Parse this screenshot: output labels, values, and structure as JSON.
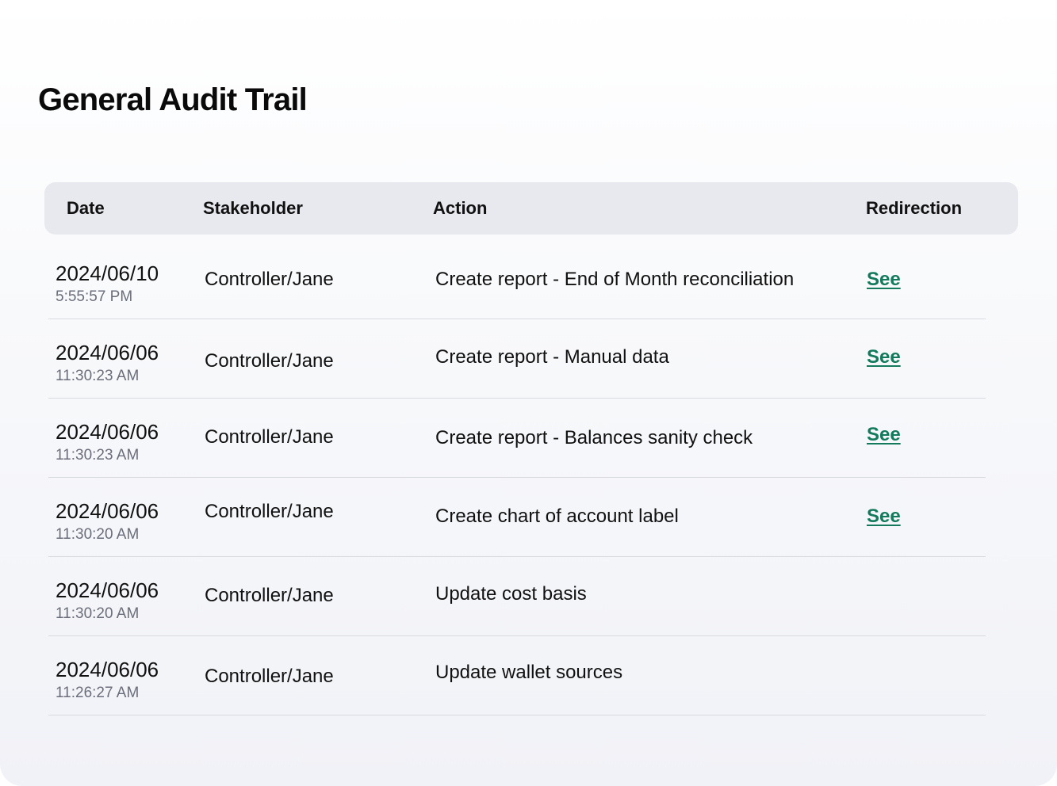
{
  "page": {
    "title": "General Audit Trail"
  },
  "table": {
    "headers": {
      "date": "Date",
      "stakeholder": "Stakeholder",
      "action": "Action",
      "redirection": "Redirection"
    },
    "rows": [
      {
        "date": "2024/06/10",
        "time": "5:55:57 PM",
        "stakeholder": "Controller/Jane",
        "action": "Create report - End of Month reconciliation",
        "link": "See"
      },
      {
        "date": "2024/06/06",
        "time": "11:30:23 AM",
        "stakeholder": "Controller/Jane",
        "action": "Create report - Manual data",
        "link": "See"
      },
      {
        "date": "2024/06/06",
        "time": "11:30:23 AM",
        "stakeholder": "Controller/Jane",
        "action": "Create report - Balances sanity check",
        "link": "See"
      },
      {
        "date": "2024/06/06",
        "time": "11:30:20 AM",
        "stakeholder": "Controller/Jane",
        "action": "Create chart of account label",
        "link": "See"
      },
      {
        "date": "2024/06/06",
        "time": "11:30:20 AM",
        "stakeholder": "Controller/Jane",
        "action": "Update cost basis",
        "link": ""
      },
      {
        "date": "2024/06/06",
        "time": "11:26:27 AM",
        "stakeholder": "Controller/Jane",
        "action": "Update wallet sources",
        "link": ""
      }
    ]
  },
  "colors": {
    "link": "#137a5c",
    "header_bg": "#e8e9ee",
    "muted_text": "#6b6e7a"
  }
}
